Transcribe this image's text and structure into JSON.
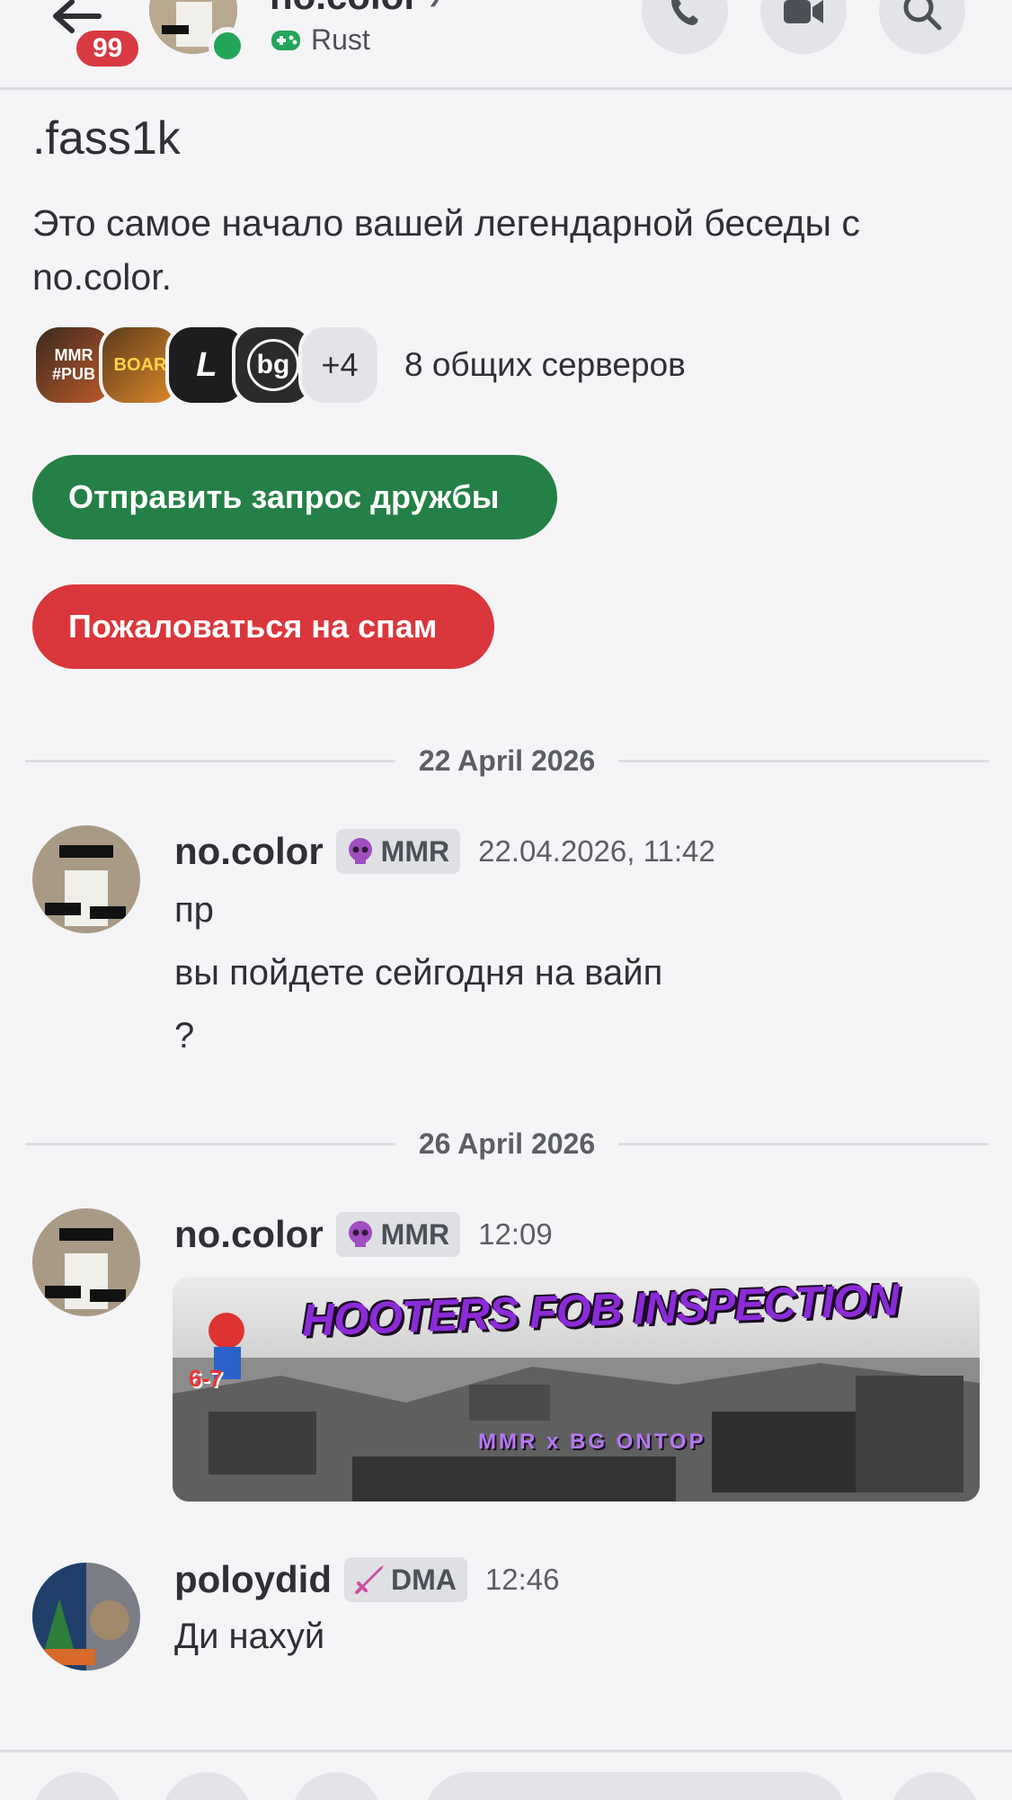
{
  "header": {
    "unread_count": "99",
    "name": "no.color",
    "activity_game": "Rust"
  },
  "intro": {
    "username": ".fass1k",
    "text": "Это самое начало вашей легендарной беседы с no.color.",
    "mutual_servers": {
      "icons": [
        "MMR #PUB",
        "BOAR",
        "L",
        "bg"
      ],
      "more": "+4",
      "label": "8 общих серверов"
    },
    "add_friend_label": "Отправить запрос дружбы",
    "report_spam_label": "Пожаловаться на спам"
  },
  "dividers": [
    "22 April 2026",
    "26 April 2026"
  ],
  "messages": [
    {
      "author": "no.color",
      "tag": "MMR",
      "timestamp": "22.04.2026, 11:42",
      "lines": [
        "пр",
        "вы пойдете сейгодня на вайп",
        "?"
      ]
    },
    {
      "author": "no.color",
      "tag": "MMR",
      "timestamp": "12:09",
      "image": {
        "title": "HOOTERS FOB INSPECTION",
        "subtitle": "MMR x BG ONTOP",
        "corner": "6-7"
      }
    },
    {
      "author": "poloydid",
      "tag": "DMA",
      "timestamp": "12:46",
      "lines": [
        "Ди нахуй"
      ]
    }
  ],
  "colors": {
    "background": "#f5f5f7",
    "green_button": "#248046",
    "red_button": "#da373c",
    "online": "#23a55a",
    "badge": "#d83a42"
  }
}
